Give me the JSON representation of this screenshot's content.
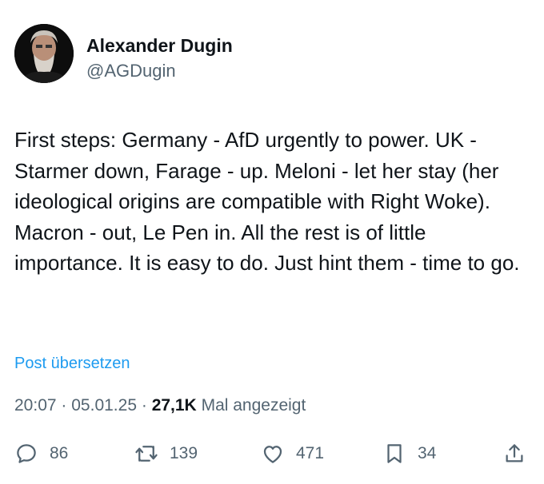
{
  "author": {
    "name": "Alexander Dugin",
    "handle": "@AGDugin"
  },
  "tweet": {
    "text": "First steps: Germany - AfD urgently to power. UK - Starmer down, Farage -  up. Meloni - let her stay (her ideological origins are compatible with Right Woke). Macron - out, Le Pen in. All the rest is of little importance. It is easy to do. Just hint them - time to go.",
    "translate_label": "Post übersetzen"
  },
  "meta": {
    "time": "20:07",
    "separator": "·",
    "date": "05.01.25",
    "views_count": "27,1K",
    "views_label": "Mal angezeigt"
  },
  "actions": {
    "reply_count": "86",
    "retweet_count": "139",
    "like_count": "471",
    "bookmark_count": "34"
  },
  "icons": [
    "reply-icon",
    "retweet-icon",
    "like-icon",
    "bookmark-icon",
    "share-icon"
  ],
  "colors": {
    "link": "#1d9bf0",
    "secondary_text": "#536471",
    "primary_text": "#0f1419"
  }
}
